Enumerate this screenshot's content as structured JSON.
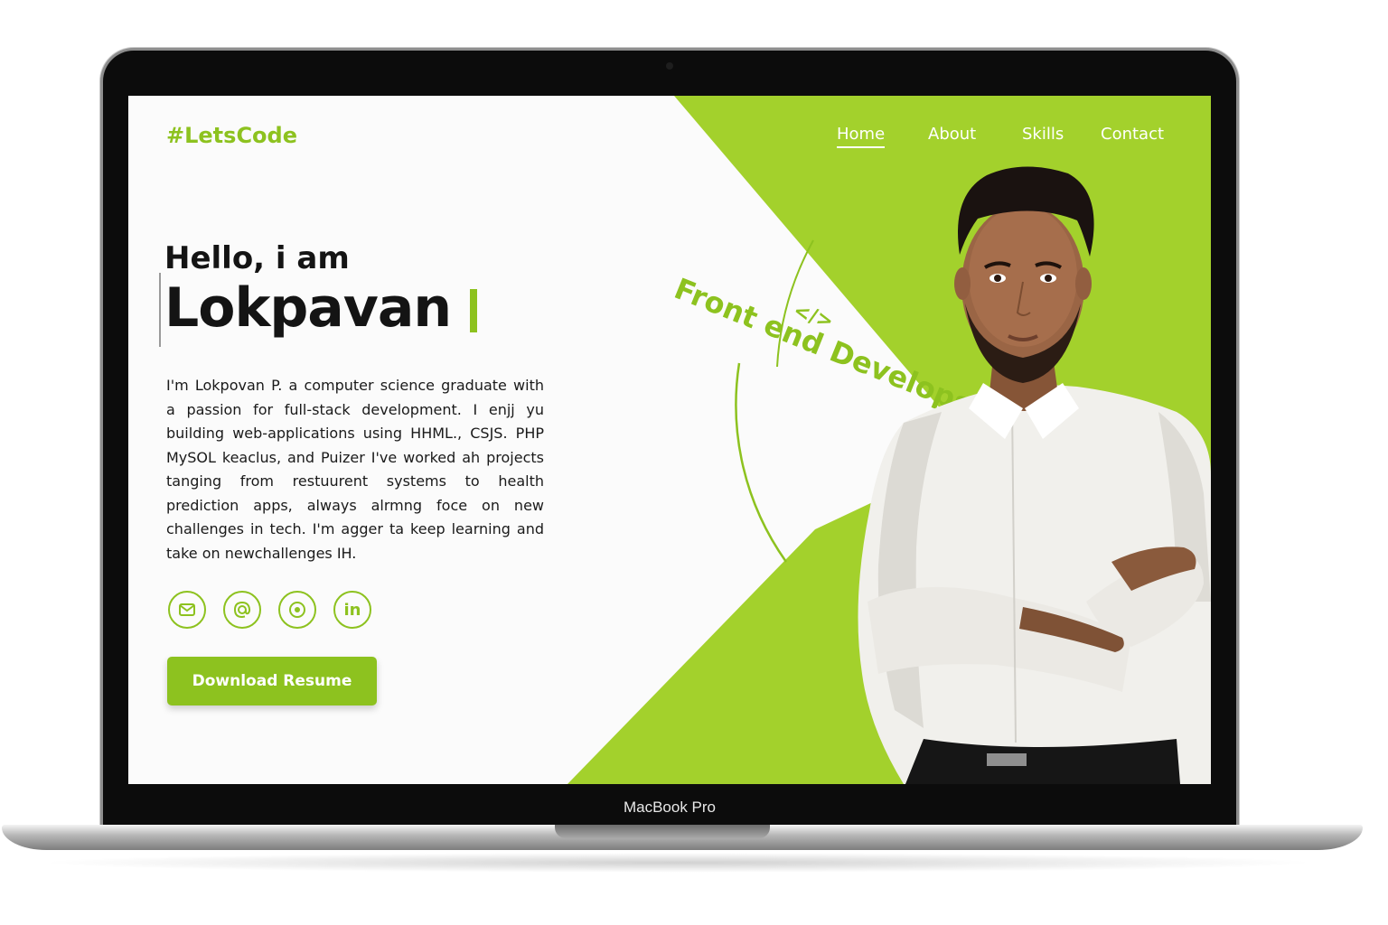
{
  "device": {
    "label": "MacBook Pro"
  },
  "header": {
    "logo": "#LetsCode",
    "nav": [
      {
        "label": "Home",
        "active": true
      },
      {
        "label": "About",
        "active": false
      },
      {
        "label": "Skills",
        "active": false
      },
      {
        "label": "Contact",
        "active": false
      }
    ]
  },
  "hero": {
    "greeting": "Hello, i am",
    "name": "Lokpavan",
    "bio": "I'm Lokpovan P. a computer science graduate with a passion for full-stack development. I enjj yu building web-applications using HHML., CSJS. PHP MySOL keaclus, and Puizer I've worked ah projects tanging from restuurent systems to health prediction apps, always alrmng foce on new challenges in tech. I'm agger ta keep learning and take on newchallenges IH.",
    "role_badge": "Front end Develops",
    "code_symbol": "</>",
    "socials": [
      {
        "icon": "mail-icon"
      },
      {
        "icon": "at-icon"
      },
      {
        "icon": "target-icon"
      },
      {
        "icon": "linkedin-icon",
        "text": "in"
      }
    ],
    "cta": "Download Resume"
  },
  "colors": {
    "accent": "#a3d12c",
    "accent_text": "#8dc21f",
    "text": "#141414"
  }
}
